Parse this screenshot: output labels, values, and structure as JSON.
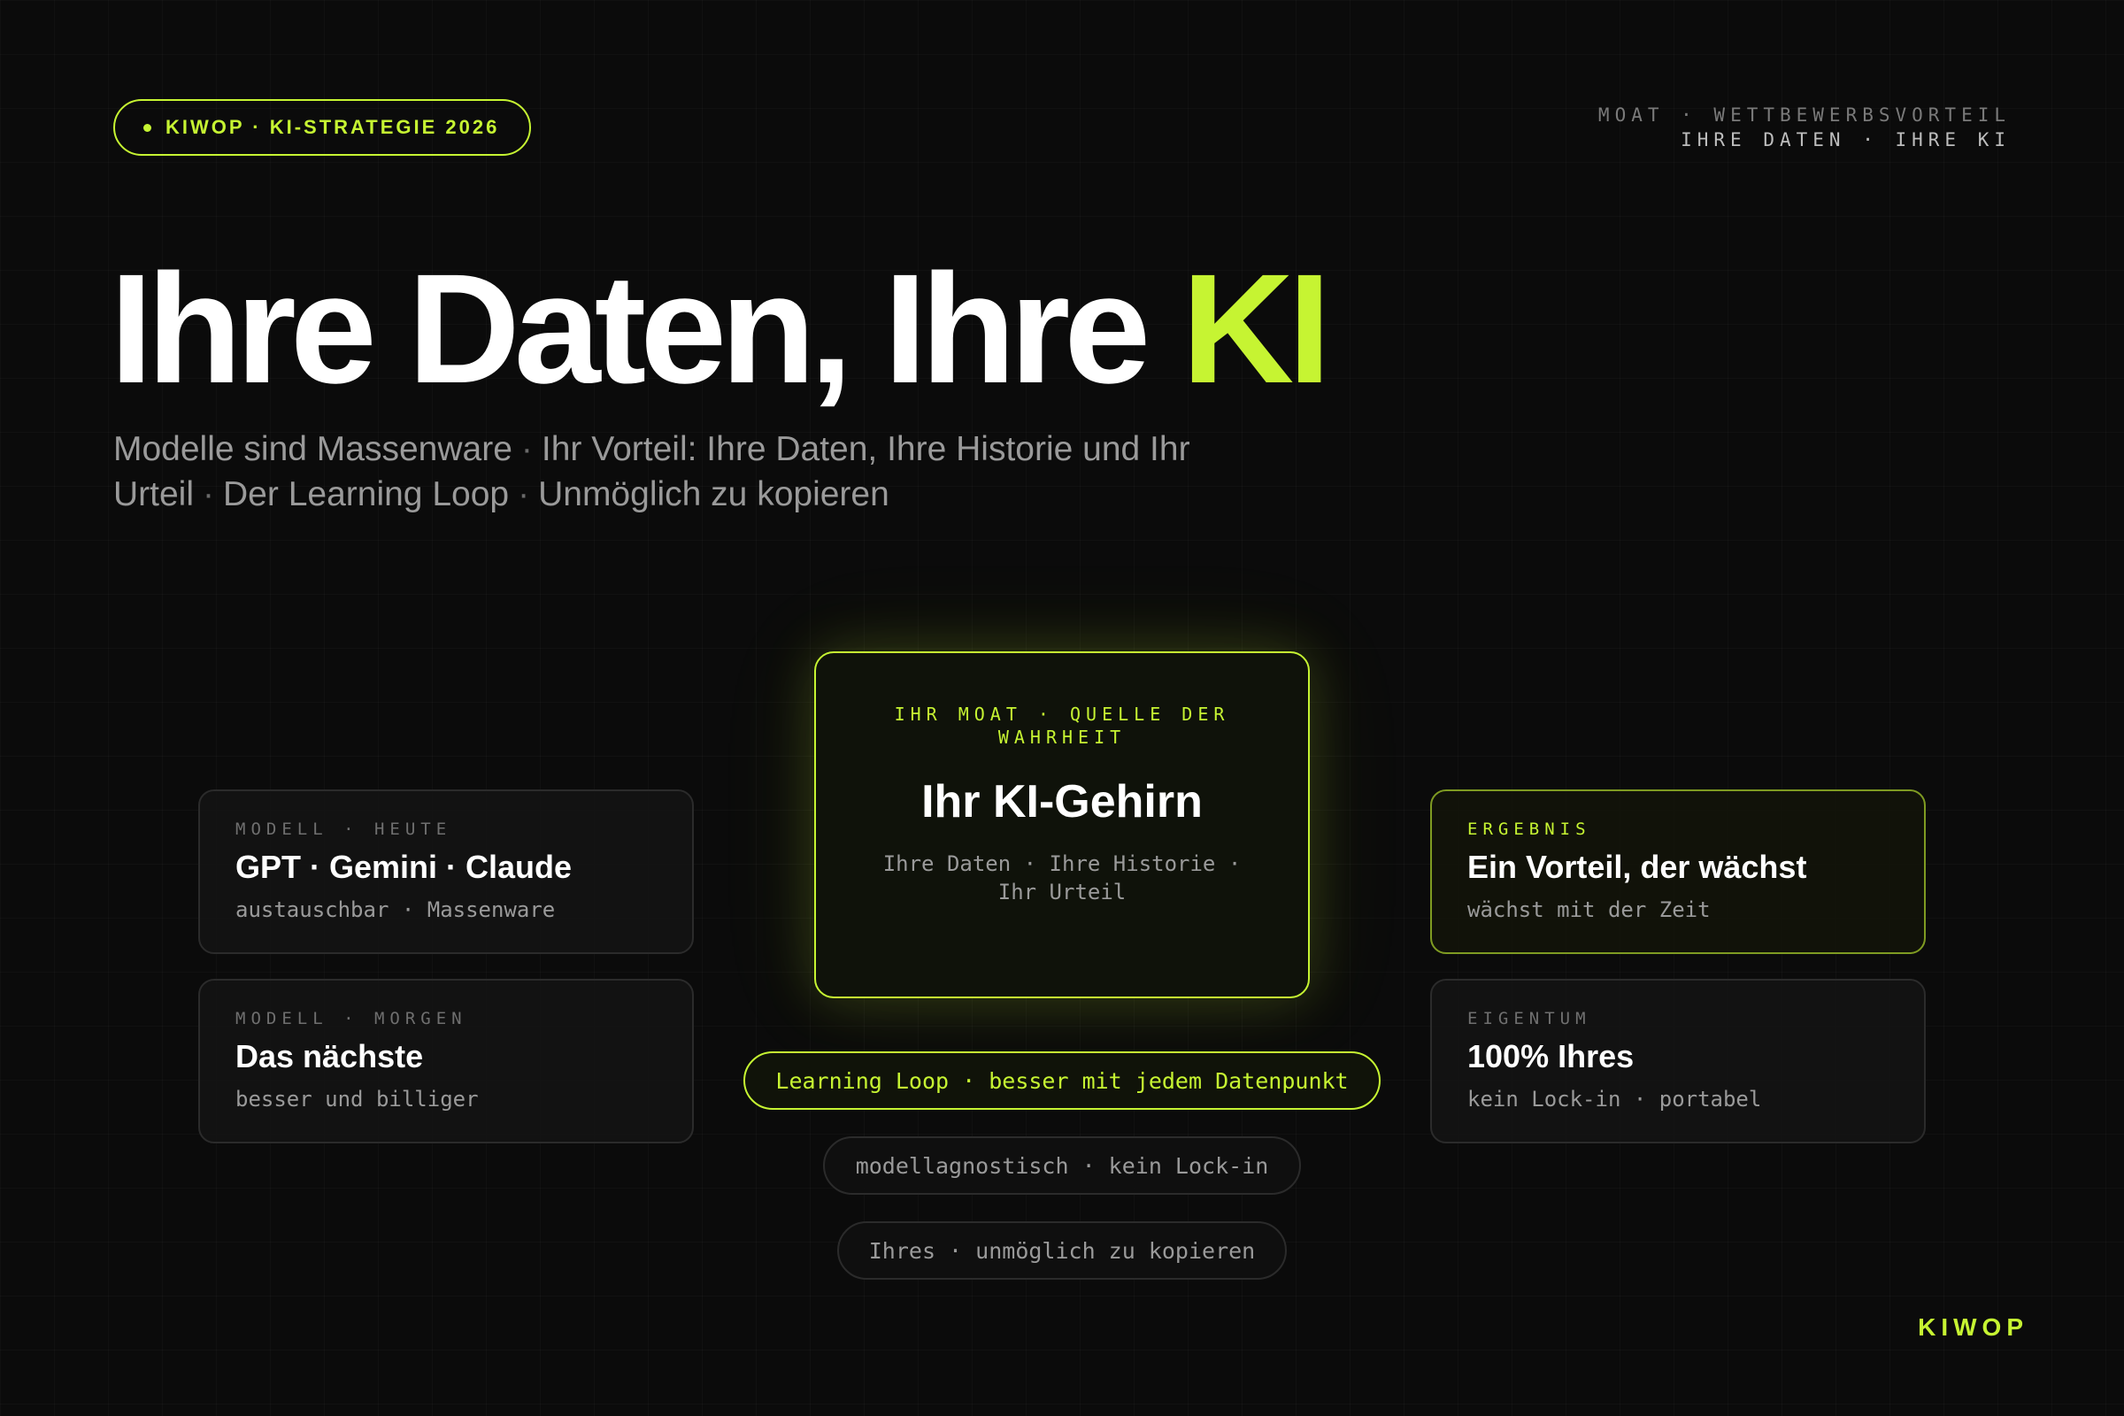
{
  "header": {
    "brand_pill": "KIWOP · KI-STRATEGIE 2026",
    "meta_line1": "MOAT · WETTBEWERBSVORTEIL",
    "meta_line2": "IHRE DATEN · IHRE KI"
  },
  "hero": {
    "title_main": "Ihre Daten, Ihre",
    "title_accent": "KI",
    "subtitle": {
      "p1": "Modelle sind Massenware",
      "p2": "Ihr Vorteil: Ihre Daten, Ihre Historie und Ihr Urteil",
      "p3": "Der Learning Loop",
      "p4": "Unmöglich zu kopieren",
      "sep": "·"
    }
  },
  "cards": {
    "model_today": {
      "label": "MODELL · HEUTE",
      "title": "GPT · Gemini · Claude",
      "sub": "austauschbar · Massenware"
    },
    "model_tomorrow": {
      "label": "MODELL · MORGEN",
      "title": "Das nächste",
      "sub": "besser und billiger"
    },
    "result": {
      "label": "ERGEBNIS",
      "title": "Ein Vorteil, der wächst",
      "sub": "wächst mit der Zeit"
    },
    "ownership": {
      "label": "EIGENTUM",
      "title": "100% Ihres",
      "sub": "kein Lock-in · portabel"
    }
  },
  "core": {
    "label": "IHR MOAT · QUELLE DER WAHRHEIT",
    "title": "Ihr KI-Gehirn",
    "sub": "Ihre Daten · Ihre Historie · Ihr Urteil"
  },
  "pills": {
    "learning_loop": "Learning Loop · besser mit jedem Datenpunkt",
    "agnostic": "modellagnostisch · kein Lock-in",
    "ihres": "Ihres · unmöglich zu kopieren"
  },
  "footer": {
    "brand": "KIWOP"
  },
  "colors": {
    "accent": "#c6f432",
    "background": "#0b0b0b",
    "muted": "#9a9a9a"
  }
}
